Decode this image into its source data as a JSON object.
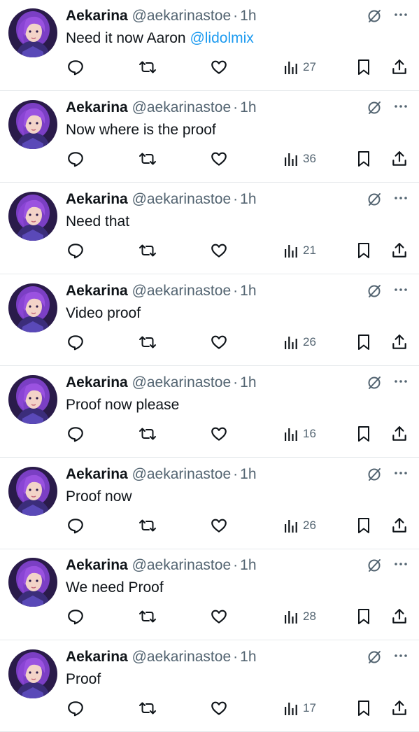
{
  "colors": {
    "text": "#0f1419",
    "muted": "#536471",
    "link": "#1d9bf0",
    "divider": "#e6e9ec"
  },
  "icons": [
    "reply-icon",
    "retweet-icon",
    "like-icon",
    "views-icon",
    "bookmark-icon",
    "share-icon",
    "grok-icon",
    "more-icon"
  ],
  "tweets": [
    {
      "name": "Aekarina",
      "handle": "@aekarinastoe",
      "separator": "·",
      "time": "1h",
      "text": "Need it now Aaron ",
      "mention": "@lidolmix",
      "views": "27"
    },
    {
      "name": "Aekarina",
      "handle": "@aekarinastoe",
      "separator": "·",
      "time": "1h",
      "text": "Now where is the proof",
      "mention": "",
      "views": "36"
    },
    {
      "name": "Aekarina",
      "handle": "@aekarinastoe",
      "separator": "·",
      "time": "1h",
      "text": "Need that",
      "mention": "",
      "views": "21"
    },
    {
      "name": "Aekarina",
      "handle": "@aekarinastoe",
      "separator": "·",
      "time": "1h",
      "text": "Video proof",
      "mention": "",
      "views": "26"
    },
    {
      "name": "Aekarina",
      "handle": "@aekarinastoe",
      "separator": "·",
      "time": "1h",
      "text": "Proof now please",
      "mention": "",
      "views": "16"
    },
    {
      "name": "Aekarina",
      "handle": "@aekarinastoe",
      "separator": "·",
      "time": "1h",
      "text": "Proof now",
      "mention": "",
      "views": "26"
    },
    {
      "name": "Aekarina",
      "handle": "@aekarinastoe",
      "separator": "·",
      "time": "1h",
      "text": "We need Proof",
      "mention": "",
      "views": "28"
    },
    {
      "name": "Aekarina",
      "handle": "@aekarinastoe",
      "separator": "·",
      "time": "1h",
      "text": "Proof",
      "mention": "",
      "views": "17"
    }
  ]
}
